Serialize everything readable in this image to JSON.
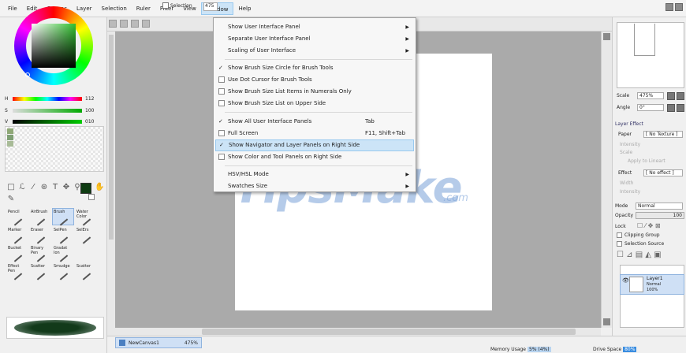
{
  "menu": [
    "File",
    "Edit",
    "Canvas",
    "Layer",
    "Selection",
    "Ruler",
    "Filter",
    "View",
    "Window",
    "Help"
  ],
  "active_menu": "Window",
  "color_sliders": [
    {
      "label": "H",
      "value": "112"
    },
    {
      "label": "S",
      "value": "100"
    },
    {
      "label": "V",
      "value": "010"
    }
  ],
  "tools": [
    {
      "label": "Pencil"
    },
    {
      "label": "AirBrush"
    },
    {
      "label": "Brush"
    },
    {
      "label": "Water Color"
    },
    {
      "label": "Marker"
    },
    {
      "label": "Eraser"
    },
    {
      "label": "SelPen"
    },
    {
      "label": "SelErs"
    },
    {
      "label": "Bucket"
    },
    {
      "label": "Binary Pen"
    },
    {
      "label": "Gradat Ion"
    },
    {
      "label": ""
    },
    {
      "label": "Effect Pen"
    },
    {
      "label": "Scatter"
    },
    {
      "label": "Smudge"
    },
    {
      "label": "Scatter"
    }
  ],
  "canvas_toolbar": {
    "selection_label": "Selection",
    "zoom": "475"
  },
  "window_menu": {
    "items": [
      {
        "label": "Show User Interface Panel",
        "type": "sub"
      },
      {
        "label": "Separate User Interface Panel",
        "type": "sub"
      },
      {
        "label": "Scaling of User Interface",
        "type": "sub"
      },
      {
        "label": "Show Brush Size Circle for Brush Tools",
        "type": "check",
        "checked": true
      },
      {
        "label": "Use Dot Cursor for Brush Tools",
        "type": "check",
        "checked": false
      },
      {
        "label": "Show Brush Size List Items in Numerals Only",
        "type": "check",
        "checked": false
      },
      {
        "label": "Show Brush Size List on Upper Side",
        "type": "check",
        "checked": false
      },
      {
        "label": "Show All User Interface Panels",
        "type": "check",
        "checked": true,
        "shortcut": "Tab"
      },
      {
        "label": "Full Screen",
        "type": "check",
        "checked": false,
        "shortcut": "F11, Shift+Tab"
      },
      {
        "label": "Show Navigator and Layer Panels on Right Side",
        "type": "check",
        "checked": true,
        "highlighted": true
      },
      {
        "label": "Show Color and Tool Panels on Right Side",
        "type": "check",
        "checked": false
      },
      {
        "label": "HSV/HSL Mode",
        "type": "sub"
      },
      {
        "label": "Swatches Size",
        "type": "sub"
      }
    ]
  },
  "watermark": {
    "main": "TipsMake",
    "suffix": ".com"
  },
  "navigator": {
    "scale_label": "Scale",
    "scale_value": "475%",
    "angle_label": "Angle",
    "angle_value": "0°"
  },
  "layer_effect": {
    "title": "Layer Effect",
    "paper_label": "Paper",
    "paper_value": "[ No Texture ]",
    "intensity_label": "Intensity",
    "scale_label": "Scale",
    "apply_label": "Apply to Lineart",
    "effect_label": "Effect",
    "effect_value": "[ No effect ]",
    "width_label": "Width",
    "intensity2_label": "Intensity"
  },
  "layer_props": {
    "mode_label": "Mode",
    "mode_value": "Normal",
    "opacity_label": "Opacity",
    "opacity_value": "100",
    "lock_label": "Lock",
    "clipping_label": "Clipping Group",
    "selsource_label": "Selection Source"
  },
  "layer": {
    "name": "Layer1",
    "mode": "Normal",
    "opacity": "100%"
  },
  "canvas_tab": {
    "name": "NewCanvas1",
    "zoom": "475%"
  },
  "status": {
    "memory_label": "Memory Usage",
    "memory_value": "5% (4%)",
    "drive_label": "Drive Space",
    "drive_value": "80%"
  }
}
